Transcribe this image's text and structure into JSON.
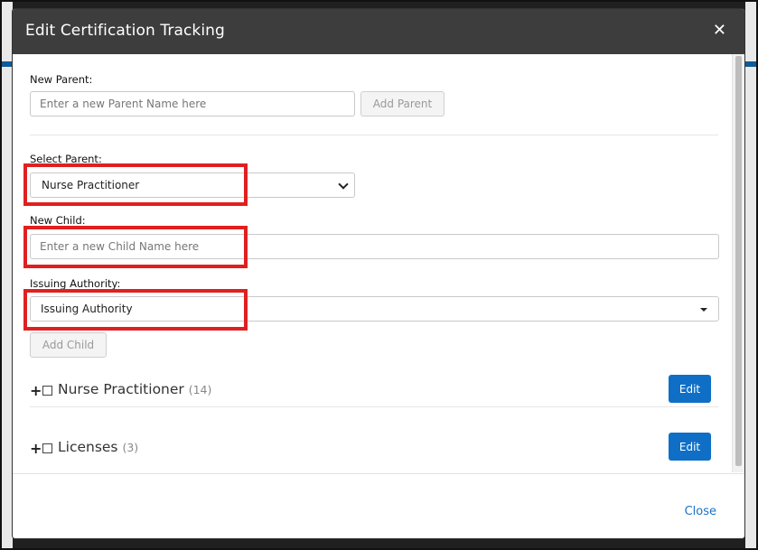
{
  "modal": {
    "title": "Edit Certification Tracking",
    "close_glyph": "✕"
  },
  "new_parent": {
    "label": "New Parent:",
    "placeholder": "Enter a new Parent Name here",
    "button": "Add Parent"
  },
  "select_parent": {
    "label": "Select Parent:",
    "value": "Nurse Practitioner"
  },
  "new_child": {
    "label": "New Child:",
    "placeholder": "Enter a new Child Name here"
  },
  "issuing_authority": {
    "label": "Issuing Authority:",
    "value": "Issuing Authority"
  },
  "add_child_button": "Add Child",
  "tree": [
    {
      "name": "Nurse Practitioner",
      "count": "(14)",
      "edit": "Edit"
    },
    {
      "name": "Licenses",
      "count": "(3)",
      "edit": "Edit"
    }
  ],
  "footer": {
    "close": "Close"
  },
  "colors": {
    "header": "#3d3d3d",
    "primary": "#0f6fc6",
    "highlight": "#e02020",
    "link": "#1a73c9"
  }
}
